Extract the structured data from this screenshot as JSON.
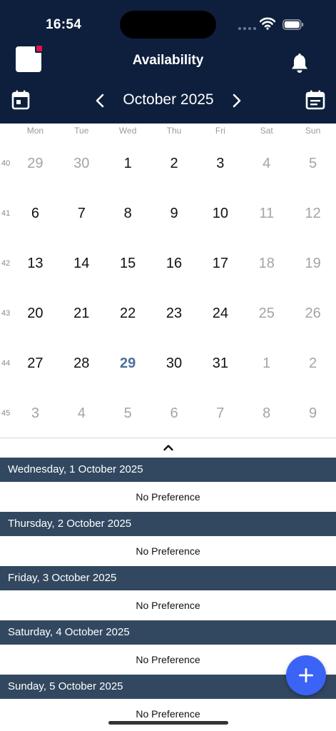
{
  "status_bar": {
    "time": "16:54"
  },
  "header": {
    "title": "Availability",
    "month_label": "October 2025"
  },
  "weekdays": [
    "Mon",
    "Tue",
    "Wed",
    "Thu",
    "Fri",
    "Sat",
    "Sun"
  ],
  "weeks": [
    {
      "number": "40",
      "days": [
        {
          "label": "29",
          "state": "muted"
        },
        {
          "label": "30",
          "state": "muted"
        },
        {
          "label": "1",
          "state": "normal"
        },
        {
          "label": "2",
          "state": "normal"
        },
        {
          "label": "3",
          "state": "normal"
        },
        {
          "label": "4",
          "state": "muted"
        },
        {
          "label": "5",
          "state": "muted"
        }
      ]
    },
    {
      "number": "41",
      "days": [
        {
          "label": "6",
          "state": "normal"
        },
        {
          "label": "7",
          "state": "normal"
        },
        {
          "label": "8",
          "state": "normal"
        },
        {
          "label": "9",
          "state": "normal"
        },
        {
          "label": "10",
          "state": "normal"
        },
        {
          "label": "11",
          "state": "muted"
        },
        {
          "label": "12",
          "state": "muted"
        }
      ]
    },
    {
      "number": "42",
      "days": [
        {
          "label": "13",
          "state": "normal"
        },
        {
          "label": "14",
          "state": "normal"
        },
        {
          "label": "15",
          "state": "normal"
        },
        {
          "label": "16",
          "state": "normal"
        },
        {
          "label": "17",
          "state": "normal"
        },
        {
          "label": "18",
          "state": "muted"
        },
        {
          "label": "19",
          "state": "muted"
        }
      ]
    },
    {
      "number": "43",
      "days": [
        {
          "label": "20",
          "state": "normal"
        },
        {
          "label": "21",
          "state": "normal"
        },
        {
          "label": "22",
          "state": "normal"
        },
        {
          "label": "23",
          "state": "normal"
        },
        {
          "label": "24",
          "state": "normal"
        },
        {
          "label": "25",
          "state": "muted"
        },
        {
          "label": "26",
          "state": "muted"
        }
      ]
    },
    {
      "number": "44",
      "days": [
        {
          "label": "27",
          "state": "normal"
        },
        {
          "label": "28",
          "state": "normal"
        },
        {
          "label": "29",
          "state": "today"
        },
        {
          "label": "30",
          "state": "normal"
        },
        {
          "label": "31",
          "state": "normal"
        },
        {
          "label": "1",
          "state": "muted"
        },
        {
          "label": "2",
          "state": "muted"
        }
      ]
    },
    {
      "number": "45",
      "days": [
        {
          "label": "3",
          "state": "muted"
        },
        {
          "label": "4",
          "state": "muted"
        },
        {
          "label": "5",
          "state": "muted"
        },
        {
          "label": "6",
          "state": "muted"
        },
        {
          "label": "7",
          "state": "muted"
        },
        {
          "label": "8",
          "state": "muted"
        },
        {
          "label": "9",
          "state": "muted"
        }
      ]
    }
  ],
  "availability": [
    {
      "date": "Wednesday, 1 October 2025",
      "preference": "No Preference"
    },
    {
      "date": "Thursday, 2 October 2025",
      "preference": "No Preference"
    },
    {
      "date": "Friday, 3 October 2025",
      "preference": "No Preference"
    },
    {
      "date": "Saturday, 4 October 2025",
      "preference": "No Preference"
    },
    {
      "date": "Sunday, 5 October 2025",
      "preference": "No Preference"
    }
  ],
  "colors": {
    "header_bg": "#0d1f3c",
    "date_header_bg": "#324860",
    "today": "#4a6f9d",
    "fab": "#3b63f5",
    "logo_accent": "#e3124c"
  },
  "icons": {
    "logo": "app-logo-icon",
    "notifications": "bell-icon",
    "calendar_left": "calendar-icon",
    "calendar_right": "calendar-list-icon",
    "prev": "chevron-left-icon",
    "next": "chevron-right-icon",
    "collapse": "chevron-up-icon",
    "add": "plus-icon"
  }
}
